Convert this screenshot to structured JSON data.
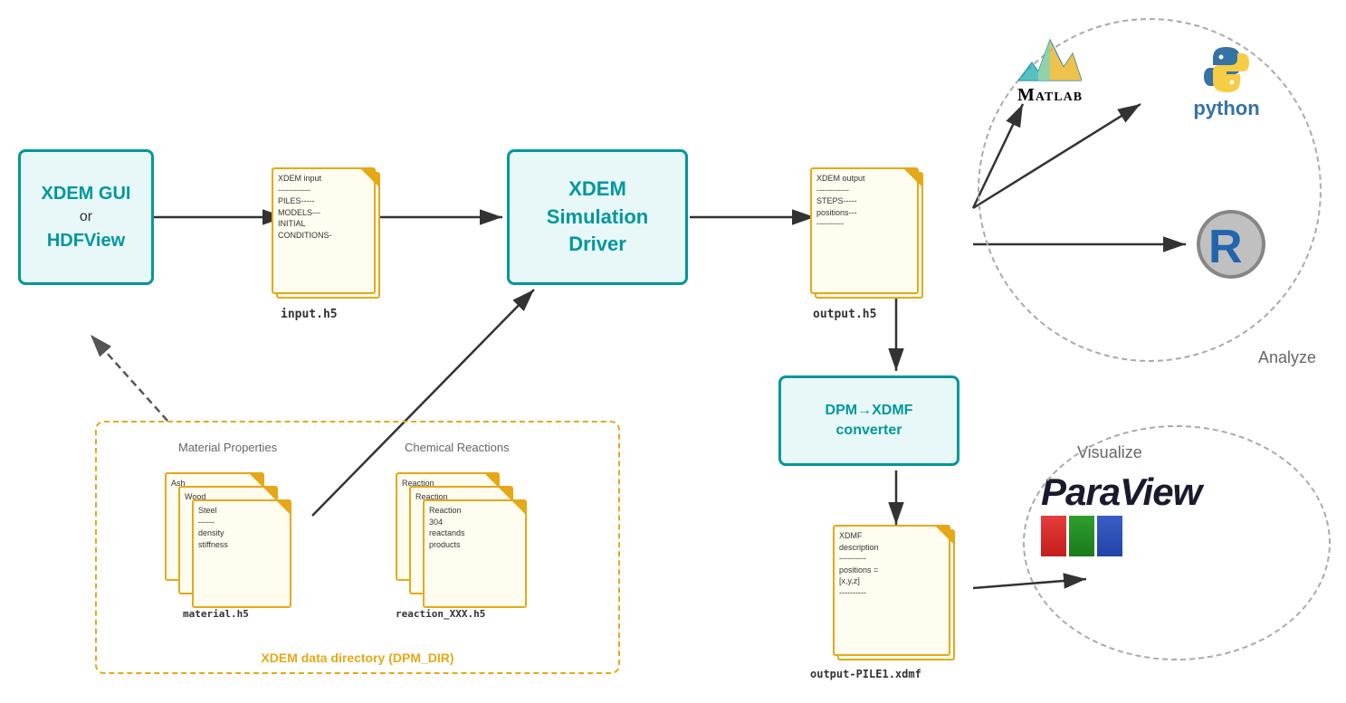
{
  "xdem_gui": {
    "line1": "XDEM GUI",
    "separator": "or",
    "line2": "HDFView"
  },
  "sim_driver": {
    "line1": "XDEM",
    "line2": "Simulation",
    "line3": "Driver"
  },
  "dpm_xdmf": {
    "line1": "DPM→XDMF",
    "line2": "converter"
  },
  "input_doc": {
    "label": "input.h5",
    "content": "XDEM input\n------------\nPILES-----\nMODELS---\nINITIAL\nCONDITIONS-"
  },
  "output_doc": {
    "label": "output.h5",
    "content": "XDEM output\n------------\nSTEPS-----\npositions---\n----------"
  },
  "xdmf_doc": {
    "label": "output-PILE1.xdmf",
    "content": "XDMF\ndescription\n----------\npositions =\n[x,y,z]\n----------"
  },
  "material_doc": {
    "label": "material.h5",
    "content_back": "Ash",
    "content_mid": "Wood",
    "content_front": "Steel\n------\ndensity\nstiffness"
  },
  "reaction_doc": {
    "label": "reaction_XXX.h5",
    "content_back": "Reaction",
    "content_mid": "Reaction",
    "content_front": "Reaction\n304\nreactands\nproducts"
  },
  "data_dir": {
    "label": "XDEM data directory (DPM_DIR)",
    "material_label": "Material Properties",
    "reaction_label": "Chemical Reactions"
  },
  "matlab_label": "MATLAB",
  "python_label": "python",
  "r_label": "R",
  "analyze_label": "Analyze",
  "visualize_label": "Visualize",
  "paraview_label": "ParaView"
}
